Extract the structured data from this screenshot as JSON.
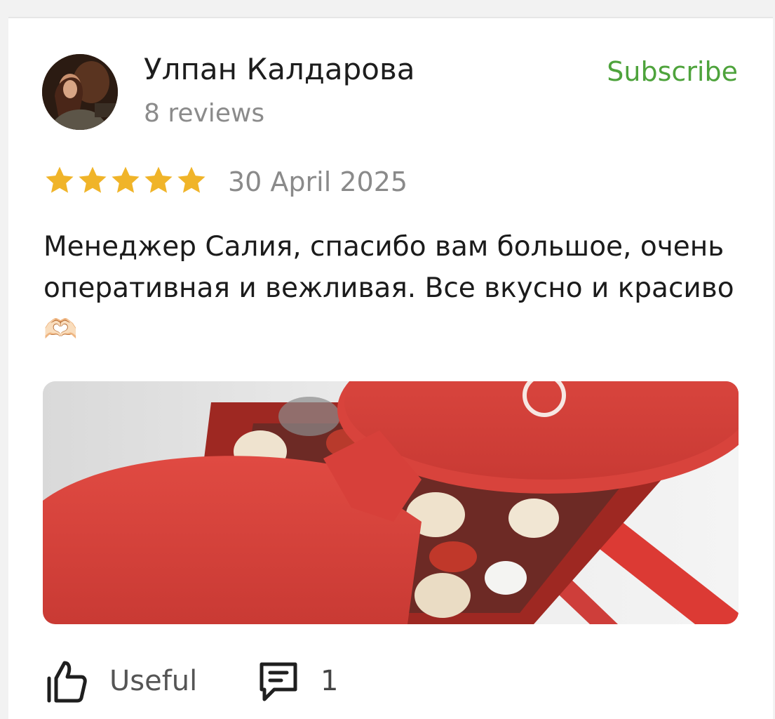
{
  "review": {
    "author_name": "Улпан Калдарова",
    "review_count": "8 reviews",
    "subscribe_label": "Subscribe",
    "rating": 5,
    "rating_max": 5,
    "date": "30 April 2025",
    "text": "Менеджер Салия, спасибо вам большое, очень оперативная и вежливая. Все вкусно и красиво🫶🏻",
    "actions": {
      "useful_label": "Useful",
      "comments_count": "1"
    }
  },
  "colors": {
    "accent_green": "#4ea33c",
    "star_gold": "#f0b429",
    "muted_text": "#8b8b8b"
  },
  "icons": {
    "useful": "thumbs-up-icon",
    "comments": "comment-icon",
    "rating": "star-icon"
  }
}
